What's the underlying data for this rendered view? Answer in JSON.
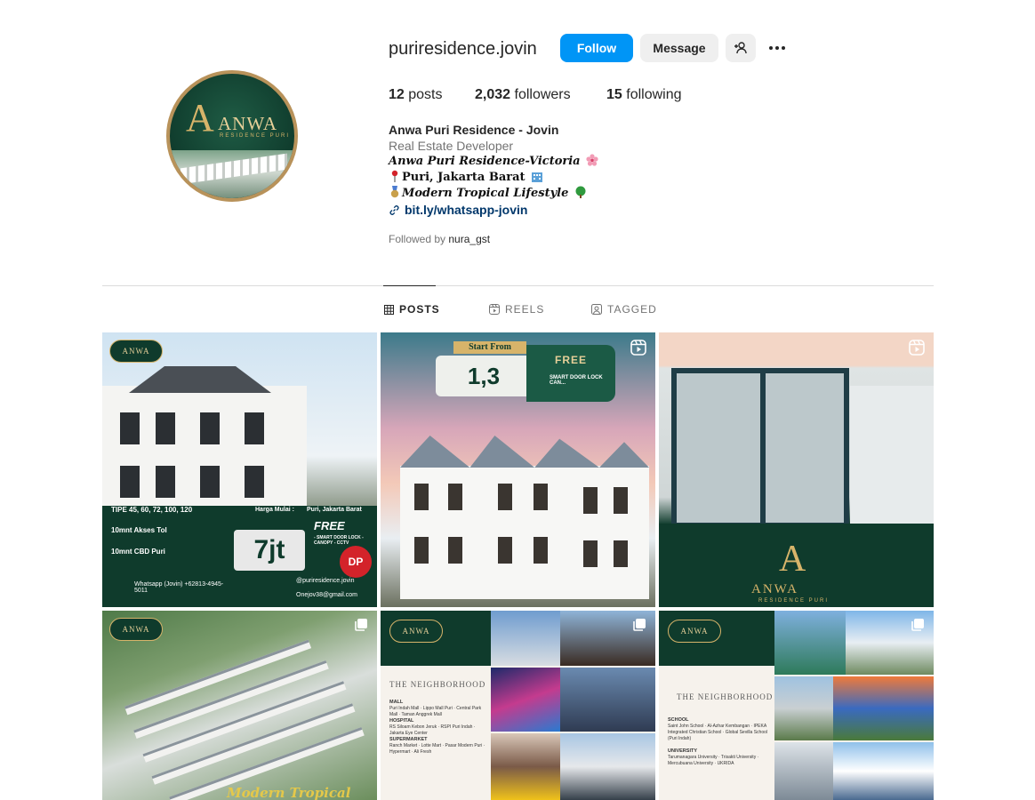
{
  "profile": {
    "username": "puriresidence.jovin",
    "follow_label": "Follow",
    "message_label": "Message",
    "avatar": {
      "logo_letter": "A",
      "logo_word": "ANWA",
      "logo_sub": "RESIDENCE PURI"
    },
    "stats": {
      "posts_count": "12",
      "posts_label": "posts",
      "followers_count": "2,032",
      "followers_label": "followers",
      "following_count": "15",
      "following_label": "following"
    },
    "bio": {
      "name": "Anwa Puri Residence - Jovin",
      "category": "Real Estate Developer",
      "line1": "Anwa Puri Residence-Victoria",
      "line2": "Puri, Jakarta Barat",
      "line3": "Modern Tropical Lifestyle",
      "link": "bit.ly/whatsapp-jovin"
    },
    "followed_by_prefix": "Followed by",
    "followed_by_user": "nura_gst"
  },
  "tabs": [
    {
      "label": "POSTS",
      "active": true
    },
    {
      "label": "REELS",
      "active": false
    },
    {
      "label": "TAGGED",
      "active": false
    }
  ],
  "posts": {
    "p1": {
      "brand": "ANWA",
      "type_line": "TIPE 45, 60, 72, 100, 120",
      "toll": "10mnt Akses Tol",
      "cbd": "10mnt CBD Puri",
      "harga": "Harga Mulai :",
      "location": "Puri, Jakarta Barat",
      "price": "7jt",
      "free": "FREE",
      "free_items": "- SMART DOOR LOCK  - CANOPY  - CCTV",
      "tanpa_dp": "DP",
      "whatsapp": "Whatsapp (Jovin) +62813-4945-5011",
      "instagram": "@puriresidence.jovin",
      "email": "Onejov38@gmail.com"
    },
    "p2": {
      "start": "Start From",
      "price": "1,3",
      "free": "FREE",
      "free_items": "SMART DOOR LOCK  CAN..."
    },
    "p3": {
      "letter": "A",
      "word": "ANWA",
      "sub": "RESIDENCE PURI"
    },
    "p4": {
      "brand": "ANWA",
      "slogan": "Modern Tropical Lifestyle"
    },
    "p5": {
      "brand": "ANWA",
      "title": "THE NEIGHBORHOOD",
      "h1": "MALL",
      "l1": "Puri Indah Mall · Lippo Mall Puri · Central Park Mall · Taman Anggrek Mall",
      "h2": "HOSPITAL",
      "l2": "RS Siloam Kebon Jeruk · RSPI Puri Indah · Jakarta Eye Center",
      "h3": "SUPERMARKET",
      "l3": "Ranch Market · Lotte Mart · Pasar Modern Puri · Hypermart · Ali Fresh"
    },
    "p6": {
      "brand": "ANWA",
      "title": "THE NEIGHBORHOOD",
      "h1": "SCHOOL",
      "l1": "Saint John School · Al-Azhar Kembangan · IPEKA Integrated Christian School · Global Sevilla School (Puri Indah)",
      "h2": "UNIVERSITY",
      "l2": "Tarumanagara University · Trisakti University · Mercubuana University · UKRIDA"
    }
  },
  "colors": {
    "primary": "#0095f6",
    "brand_green": "#0f3b2c",
    "brand_gold": "#d7b46a"
  }
}
